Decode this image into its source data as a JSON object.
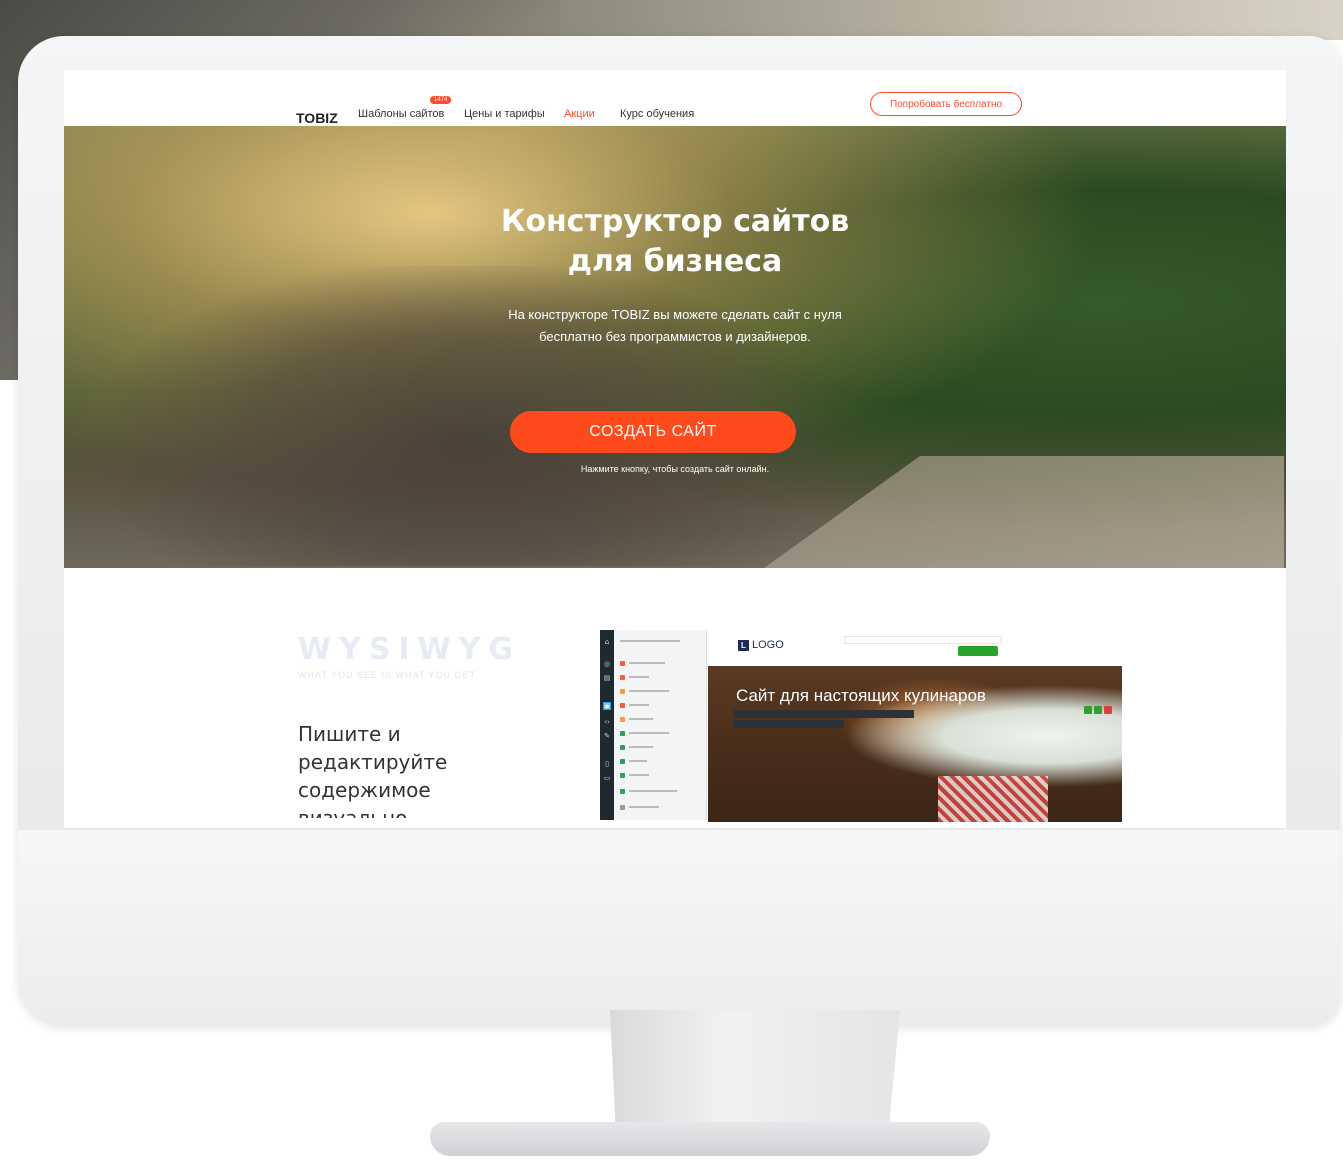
{
  "nav": {
    "brand": "TOBIZ",
    "items": [
      {
        "label": "Шаблоны сайтов",
        "badge": "1474"
      },
      {
        "label": "Цены и тарифы"
      },
      {
        "label": "Акции"
      },
      {
        "label": "Курс обучения"
      }
    ],
    "try_button": "Попробовать бесплатно"
  },
  "hero": {
    "title_line1": "Конструктор сайтов",
    "title_line2": "для бизнеса",
    "subtitle_line1": "На конструкторе TOBIZ вы можете сделать сайт с нуля",
    "subtitle_line2": "бесплатно без программистов и дизайнеров.",
    "cta": "СОЗДАТЬ САЙТ",
    "cta_note": "Нажмите кнопку, чтобы создать сайт онлайн."
  },
  "feature": {
    "title": "WYSIWYG",
    "subtitle": "WHAT YOU SEE IS WHAT YOU GET",
    "text_line1": "Пишите и",
    "text_line2": "редактируйте",
    "text_line3": "содержимое",
    "text_line4": "визуально"
  },
  "editor_preview": {
    "logo": "LOGO",
    "heading": "Сайт для настоящих кулинаров"
  },
  "colors": {
    "accent": "#ff4b2b",
    "cta": "#ff4a1c",
    "editor_green": "#29a329",
    "editor_rail": "#1f2a30"
  }
}
